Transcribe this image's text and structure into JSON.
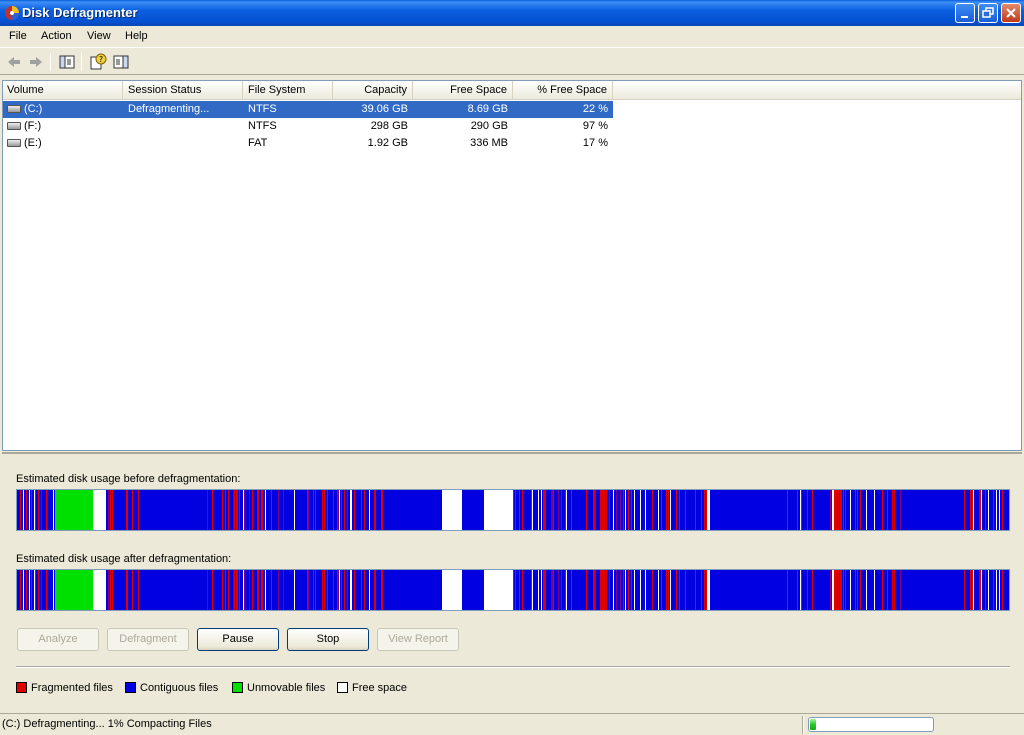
{
  "window": {
    "title": "Disk Defragmenter"
  },
  "menu": [
    "File",
    "Action",
    "View",
    "Help"
  ],
  "toolbar": {
    "icons": [
      "back-arrow-icon",
      "forward-arrow-icon",
      "show-hide-console-tree-icon",
      "help-icon",
      "show-hide-action-pane-icon"
    ]
  },
  "table": {
    "columns": [
      "Volume",
      "Session Status",
      "File System",
      "Capacity",
      "Free Space",
      "% Free Space"
    ],
    "rows": [
      {
        "volume": "(C:)",
        "status": "Defragmenting...",
        "fs": "NTFS",
        "capacity": "39.06 GB",
        "free": "8.69 GB",
        "pct": "22 %",
        "selected": true
      },
      {
        "volume": "(F:)",
        "status": "",
        "fs": "NTFS",
        "capacity": "298 GB",
        "free": "290 GB",
        "pct": "97 %",
        "selected": false
      },
      {
        "volume": "(E:)",
        "status": "",
        "fs": "FAT",
        "capacity": "1.92 GB",
        "free": "336 MB",
        "pct": "17 %",
        "selected": false
      }
    ]
  },
  "analysis": {
    "before_label": "Estimated disk usage before defragmentation:",
    "after_label": "Estimated disk usage after defragmentation:"
  },
  "buttons": {
    "analyze": "Analyze",
    "defragment": "Defragment",
    "pause": "Pause",
    "stop": "Stop",
    "view_report": "View Report"
  },
  "legend": {
    "fragmented": "Fragmented files",
    "contiguous": "Contiguous files",
    "unmovable": "Unmovable files",
    "free": "Free space"
  },
  "colors": {
    "fragmented": "#e00000",
    "contiguous": "#0000e0",
    "unmovable": "#00e000",
    "free": "#ffffff",
    "selection": "#316ac5"
  },
  "status": {
    "text": "(C:) Defragmenting... 1%  Compacting Files",
    "progress_fraction": 0.05
  }
}
